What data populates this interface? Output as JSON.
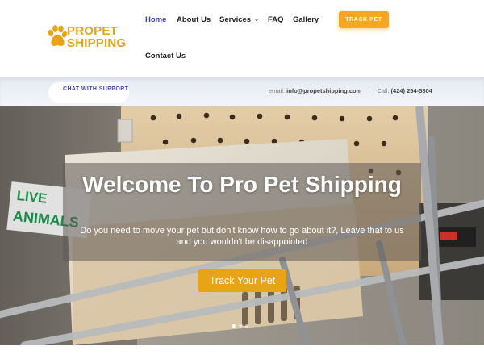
{
  "brand": {
    "line1": "PROPET",
    "line2": "SHIPPING",
    "color": "#e8a317"
  },
  "nav": {
    "items": [
      {
        "label": "Home",
        "active": true
      },
      {
        "label": "About Us"
      },
      {
        "label": "Services",
        "has_dropdown": true
      },
      {
        "label": "FAQ"
      },
      {
        "label": "Gallery"
      },
      {
        "label": "Contact Us"
      }
    ],
    "cta": "TRACK PET"
  },
  "info_bar": {
    "chat": "CHAT WITH SUPPORT",
    "email_label": "email:",
    "email": "info@propetshipping.com",
    "call_label": "Call:",
    "phone": "(424) 254-5804"
  },
  "hero": {
    "title": "Welcome To Pro Pet Shipping",
    "subtitle": "Do you need to move your pet but don't know how to go about it?, Leave that to us and you wouldn't be disappointed",
    "button": "Track Your Pet",
    "sticker_text": "LIVE ANIMALS",
    "slides": 3,
    "active_slide": 1
  },
  "colors": {
    "accent": "#e8a317",
    "nav_active": "#3a3cc7",
    "cta": "#f5a623"
  }
}
